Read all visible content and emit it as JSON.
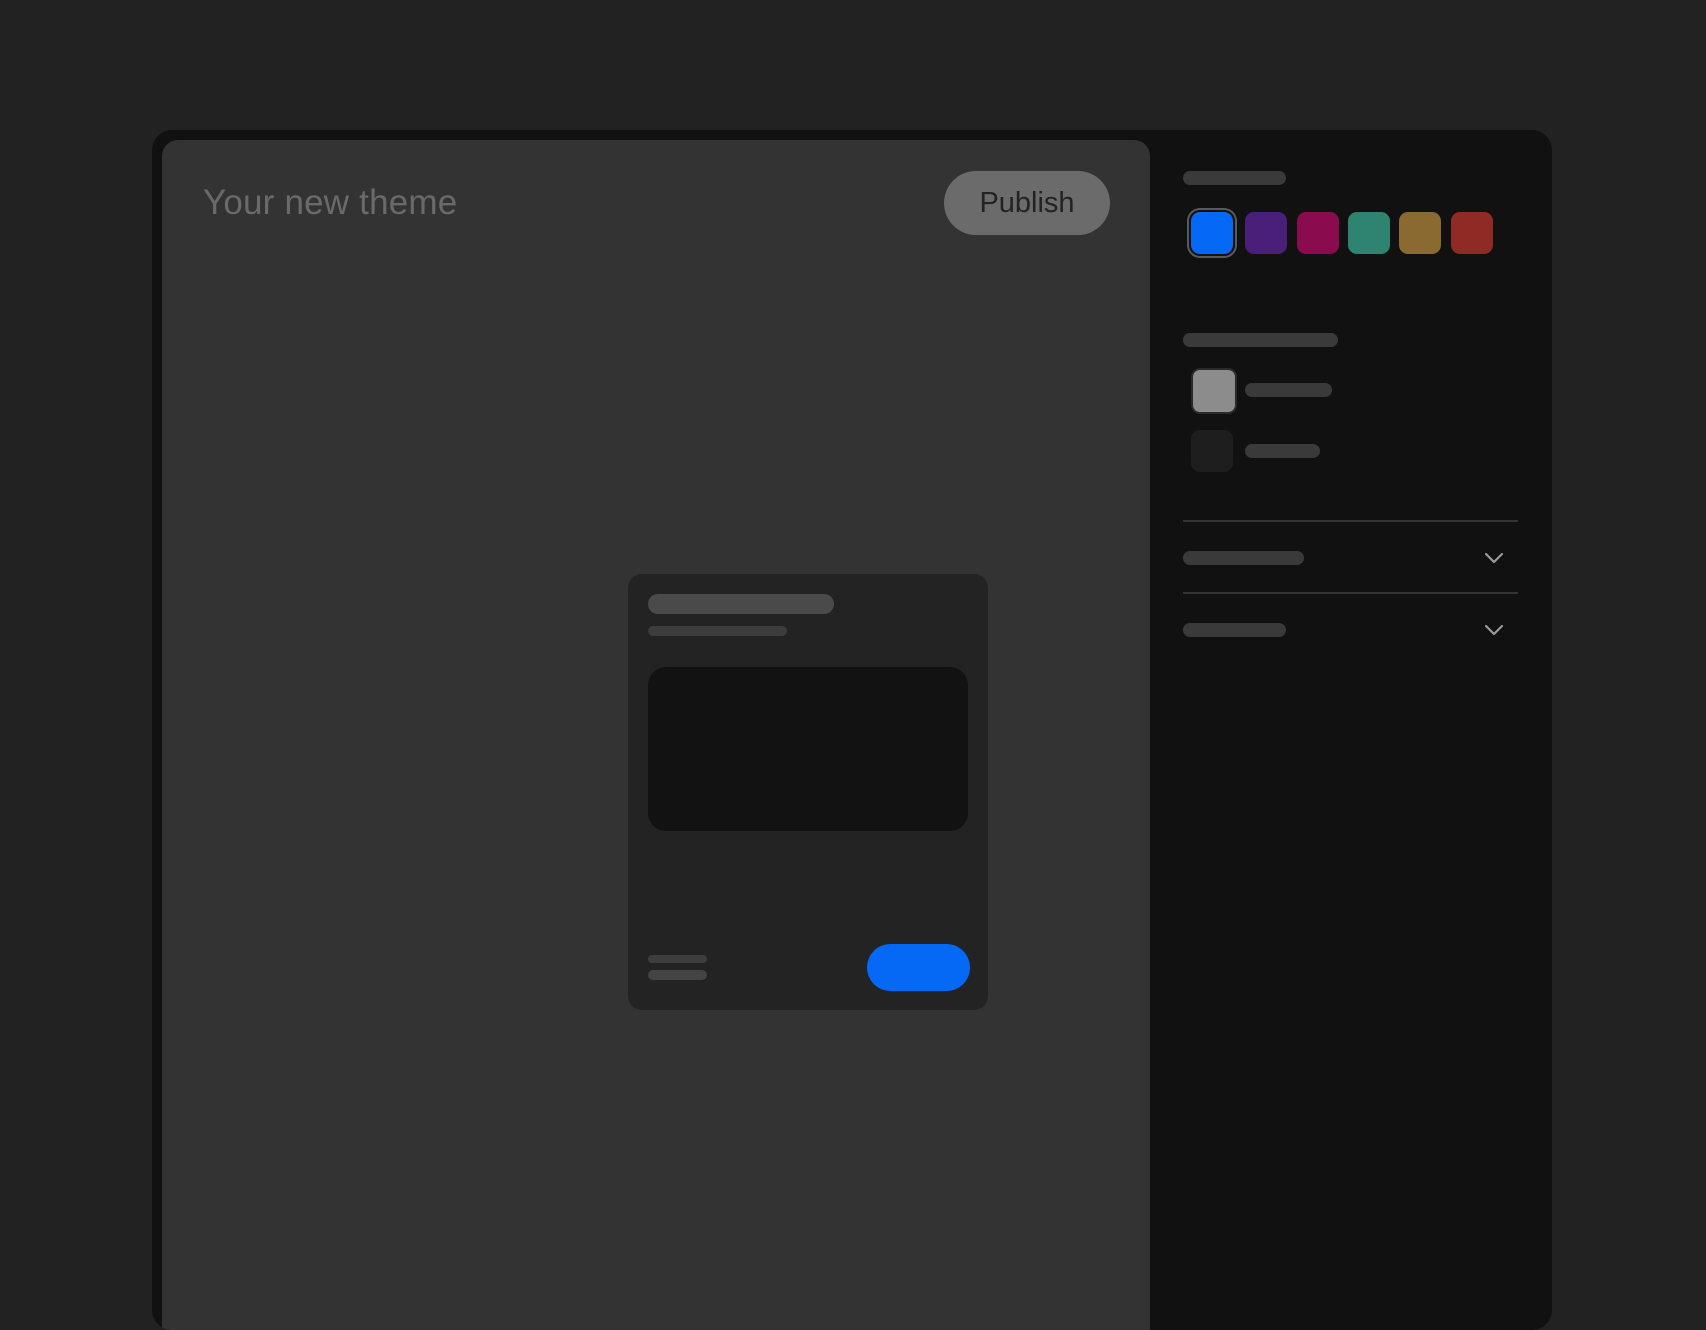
{
  "canvas": {
    "title": "Your new theme",
    "publish_label": "Publish"
  },
  "preview_card": {
    "button_color": "#0569f5"
  },
  "panel": {
    "accent_swatches": [
      {
        "color": "#0569f5",
        "selected": true
      },
      {
        "color": "#4a1f7a",
        "selected": false
      },
      {
        "color": "#8a0c4e",
        "selected": false
      },
      {
        "color": "#2e8470",
        "selected": false
      },
      {
        "color": "#8b6a32",
        "selected": false
      },
      {
        "color": "#8f2a24",
        "selected": false
      }
    ],
    "mode_options": [
      {
        "color": "#8c8c8c",
        "selected": true
      },
      {
        "color": "#1e1e1e",
        "selected": false
      }
    ],
    "accordion_icons": [
      "chevron-down-icon",
      "chevron-down-icon"
    ]
  },
  "colors": {
    "page_background": "#222222",
    "frame_background": "#111111",
    "canvas_background": "#333333",
    "card_background": "#232323",
    "accent": "#0569f5"
  }
}
